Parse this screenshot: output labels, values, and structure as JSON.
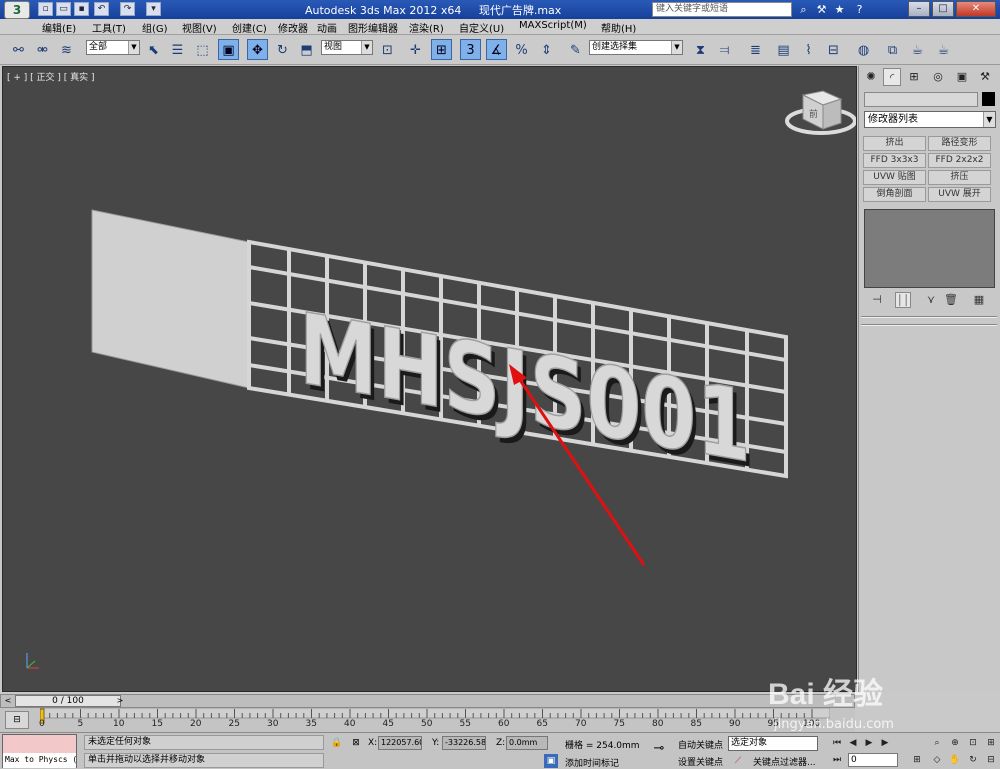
{
  "titlebar": {
    "app_name": "Autodesk 3ds Max  2012 x64",
    "file_name": "现代广告牌.max",
    "search_placeholder": "键入关键字或短语"
  },
  "menu": [
    "编辑(E)",
    "工具(T)",
    "组(G)",
    "视图(V)",
    "创建(C)",
    "修改器",
    "动画",
    "图形编辑器",
    "渲染(R)",
    "自定义(U)",
    "MAXScript(M)",
    "帮助(H)"
  ],
  "toolbar": {
    "filter": "全部",
    "ref_coord": "视图",
    "snap_3": "3",
    "selection_set": "创建选择集"
  },
  "viewport": {
    "label": "[ + ] [ 正交 ] [ 真实 ]",
    "cube_face": "前",
    "sign_text": "MHSJS001"
  },
  "panel": {
    "modifier_list": "修改器列表",
    "buttons": [
      "挤出",
      "路径变形",
      "FFD 3x3x3",
      "FFD 2x2x2",
      "UVW 贴图",
      "挤压",
      "倒角剖面",
      "UVW 展开"
    ]
  },
  "timeslider": {
    "value": "0 / 100",
    "progress": 0
  },
  "ruler": {
    "ticks": [
      "0",
      "5",
      "10",
      "15",
      "20",
      "25",
      "30",
      "35",
      "40",
      "45",
      "50",
      "55",
      "60",
      "65",
      "70",
      "75",
      "80",
      "85",
      "90",
      "95",
      "100"
    ]
  },
  "status": {
    "maxscript": "Max to Physcs (",
    "selection": "未选定任何对象",
    "prompt": "单击并拖动以选择并移动对象",
    "x_label": "X:",
    "x_value": "122057.60",
    "y_label": "Y:",
    "y_value": "-33226.58",
    "z_label": "Z:",
    "z_value": "0.0mm",
    "grid": "栅格 = 254.0mm",
    "add_tag": "添加时间标记",
    "auto_key": "自动关键点",
    "set_key": "设置关键点",
    "selected": "选定对象",
    "key_filters": "关键点过滤器...",
    "frame": "0"
  },
  "watermark": {
    "brand": "Bai 经验",
    "url": "jingyan.baidu.com"
  }
}
